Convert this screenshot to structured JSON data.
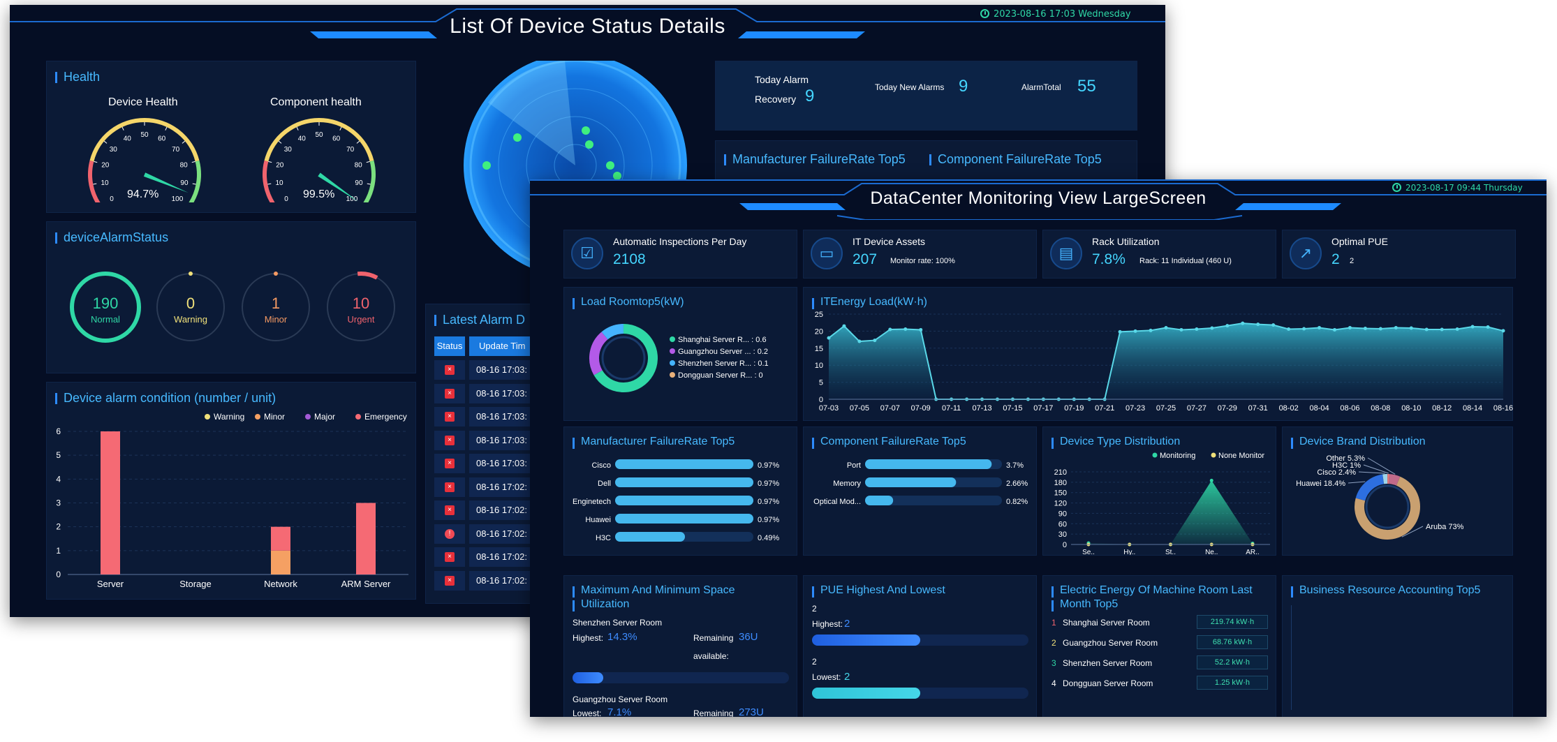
{
  "screen1": {
    "title": "List Of Device Status Details",
    "time": "2023-08-16 17:03 Wednesday",
    "health": {
      "title": "Health",
      "gauges": [
        {
          "label": "Device Health",
          "value": 94.7,
          "value_text": "94.7%",
          "ticks": [
            "0",
            "10",
            "20",
            "30",
            "40",
            "50",
            "60",
            "70",
            "80",
            "90",
            "100"
          ]
        },
        {
          "label": "Component health",
          "value": 99.5,
          "value_text": "99.5%",
          "ticks": [
            "0",
            "10",
            "20",
            "30",
            "40",
            "50",
            "60",
            "70",
            "80",
            "90",
            "100"
          ]
        }
      ]
    },
    "alarm_status": {
      "title": "deviceAlarmStatus",
      "items": [
        {
          "value": "190",
          "label": "Normal",
          "color": "#2fd8a6"
        },
        {
          "value": "0",
          "label": "Warning",
          "color": "#f0e07a"
        },
        {
          "value": "1",
          "label": "Minor",
          "color": "#f59a63"
        },
        {
          "value": "10",
          "label": "Urgent",
          "color": "#f0636d"
        }
      ]
    },
    "alarm_condition": {
      "title": "Device alarm condition (number / unit)",
      "chart_data": {
        "type": "bar",
        "categories": [
          "Server",
          "Storage",
          "Network",
          "ARM Server"
        ],
        "series": [
          {
            "name": "Warning",
            "color": "#f0e07a",
            "values": [
              0,
              0,
              0,
              0
            ]
          },
          {
            "name": "Minor",
            "color": "#f5a063",
            "values": [
              0,
              0,
              1,
              0
            ]
          },
          {
            "name": "Major",
            "color": "#a35ad6",
            "values": [
              0,
              0,
              0,
              0
            ]
          },
          {
            "name": "Emergency",
            "color": "#f56a74",
            "values": [
              6,
              0,
              1,
              3
            ]
          }
        ],
        "y_ticks": [
          "0",
          "1",
          "2",
          "3",
          "4",
          "5",
          "6"
        ],
        "ylim": [
          0,
          6
        ],
        "legend": "top-right"
      }
    },
    "summary": {
      "recovery_label_1": "Today Alarm",
      "recovery_label_2": "Recovery",
      "recovery_value": "9",
      "new_label": "Today New Alarms",
      "new_value": "9",
      "total_label": "AlarmTotal",
      "total_value": "55"
    },
    "manufacturer_title": "Manufacturer FailureRate Top5",
    "component_title": "Component FailureRate Top5",
    "latest_alarm": {
      "title": "Latest Alarm D",
      "col_status": "Status",
      "col_time": "Update Tim",
      "rows": [
        {
          "time": "08-16 17:03:",
          "kind": "x"
        },
        {
          "time": "08-16 17:03:",
          "kind": "x"
        },
        {
          "time": "08-16 17:03:",
          "kind": "x"
        },
        {
          "time": "08-16 17:03:",
          "kind": "x"
        },
        {
          "time": "08-16 17:03:",
          "kind": "x"
        },
        {
          "time": "08-16 17:02:",
          "kind": "x"
        },
        {
          "time": "08-16 17:02:",
          "kind": "x"
        },
        {
          "time": "08-16 17:02:",
          "kind": "!"
        },
        {
          "time": "08-16 17:02:",
          "kind": "x"
        },
        {
          "time": "08-16 17:02:",
          "kind": "x"
        }
      ]
    }
  },
  "screen2": {
    "title": "DataCenter Monitoring View LargeScreen",
    "time": "2023-08-17 09:44 Thursday",
    "kpis": [
      {
        "label": "Automatic Inspections Per Day",
        "value": "2108",
        "sub": "",
        "icon": "calendar-check-icon"
      },
      {
        "label": "IT Device Assets",
        "value": "207",
        "sub": "Monitor rate:  100%",
        "icon": "laptop-icon"
      },
      {
        "label": "Rack Utilization",
        "value": "7.8%",
        "sub": "Rack:  11 Individual (460 U)",
        "icon": "rack-icon"
      },
      {
        "label": "Optimal PUE",
        "value": "2",
        "sub": "2",
        "icon": "trend-chart-icon"
      }
    ],
    "load_room": {
      "title": "Load Roomtop5(kW)",
      "chart_data": {
        "type": "pie",
        "labels": [
          "Shanghai Server R... : 0.6",
          "Guangzhou Server ... : 0.2",
          "Shenzhen Server R... : 0.1",
          "Dongguan Server R... : 0"
        ],
        "values": [
          0.6,
          0.2,
          0.1,
          0
        ],
        "colors": [
          "#2fd8a6",
          "#b35ae8",
          "#45b4ff",
          "#e8b07a"
        ]
      }
    },
    "energy_load": {
      "title": "ITEnergy Load(kW·h)",
      "chart_data": {
        "type": "area",
        "x": [
          "07-03",
          "07-04",
          "07-05",
          "07-06",
          "07-07",
          "07-08",
          "07-09",
          "07-10",
          "07-11",
          "07-12",
          "07-13",
          "07-14",
          "07-15",
          "07-16",
          "07-17",
          "07-18",
          "07-19",
          "07-20",
          "07-21",
          "07-22",
          "07-23",
          "07-24",
          "07-25",
          "07-26",
          "07-27",
          "07-28",
          "07-29",
          "07-30",
          "07-31",
          "08-01",
          "08-02",
          "08-03",
          "08-04",
          "08-05",
          "08-06",
          "08-07",
          "08-08",
          "08-09",
          "08-10",
          "08-11",
          "08-12",
          "08-13",
          "08-14",
          "08-15",
          "08-16"
        ],
        "x_labels": [
          "07-03",
          "07-05",
          "07-07",
          "07-09",
          "07-11",
          "07-13",
          "07-15",
          "07-17",
          "07-19",
          "07-21",
          "07-23",
          "07-25",
          "07-27",
          "07-29",
          "07-31",
          "08-02",
          "08-04",
          "08-06",
          "08-08",
          "08-10",
          "08-12",
          "08-14",
          "08-16"
        ],
        "values": [
          18,
          21.5,
          17,
          17.3,
          20.5,
          20.6,
          20.4,
          0,
          0,
          0,
          0,
          0,
          0,
          0,
          0,
          0,
          0,
          0,
          0,
          19.8,
          20,
          20.2,
          21,
          20.4,
          20.6,
          20.9,
          21.6,
          22.3,
          22,
          21.8,
          20.6,
          20.7,
          21,
          20.4,
          21,
          20.8,
          20.7,
          21,
          20.9,
          20.5,
          20.5,
          20.6,
          21.3,
          21.2,
          20.1
        ],
        "y_ticks": [
          "0",
          "5",
          "10",
          "15",
          "20",
          "25"
        ],
        "ylim": [
          0,
          25
        ]
      }
    },
    "manufacturer": {
      "title": "Manufacturer FailureRate Top5",
      "chart_data": {
        "type": "bar",
        "categories": [
          "Cisco",
          "Dell",
          "Enginetech",
          "Huawei",
          "H3C"
        ],
        "values": [
          0.97,
          0.97,
          0.97,
          0.97,
          0.49
        ],
        "value_labels": [
          "0.97%",
          "0.97%",
          "0.97%",
          "0.97%",
          "0.49%"
        ]
      }
    },
    "component": {
      "title": "Component FailureRate Top5",
      "chart_data": {
        "type": "bar",
        "categories": [
          "Port",
          "Memory",
          "Optical Mod..."
        ],
        "values": [
          3.7,
          2.66,
          0.82
        ],
        "value_labels": [
          "3.7%",
          "2.66%",
          "0.82%"
        ]
      }
    },
    "device_type": {
      "title": "Device Type Distribution",
      "chart_data": {
        "type": "area",
        "categories": [
          "Se..",
          "Hy..",
          "St..",
          "Ne..",
          "AR.."
        ],
        "series": [
          {
            "name": "Monitoring",
            "color": "#2fd8a6",
            "values": [
              4,
              0,
              0,
              185,
              3
            ]
          },
          {
            "name": "None Monitor",
            "color": "#f0e07a",
            "values": [
              0,
              0,
              0,
              0,
              0
            ]
          }
        ],
        "y_ticks": [
          "0",
          "30",
          "60",
          "90",
          "120",
          "150",
          "180",
          "210"
        ],
        "ylim": [
          0,
          210
        ]
      }
    },
    "brand": {
      "title": "Device Brand Distribution",
      "chart_data": {
        "type": "pie",
        "labels": [
          "Aruba 73%",
          "Huawei 18.4%",
          "Cisco 2.4%",
          "H3C 1%",
          "Other 5.3%"
        ],
        "values": [
          73,
          18.4,
          2.4,
          1,
          5.3
        ],
        "colors": [
          "#c9a070",
          "#2d6fe0",
          "#9fd4e8",
          "#e87a7a",
          "#c06a8a"
        ]
      }
    },
    "space": {
      "title_1": "Maximum And Minimum Space",
      "title_2": "Utilization",
      "room_hi": "Shenzhen Server Room",
      "hi_label": "Highest:",
      "hi_value": "14.3%",
      "hi_fraction": 0.143,
      "remain_label_1": "Remaining",
      "remain_label_2": "available:",
      "hi_remain": "36U",
      "room_lo": "Guangzhou Server Room",
      "lo_label": "Lowest:",
      "lo_value": "7.1%",
      "lo_remain": "273U"
    },
    "pue": {
      "title": "PUE Highest And Lowest",
      "hi_top": "2",
      "hi_label": "Highest:",
      "hi_value": "2",
      "lo_top": "2",
      "lo_label": "Lowest:",
      "lo_value": "2",
      "hi_fraction": 0.5,
      "lo_fraction": 0.5
    },
    "electric": {
      "title_1": "Electric Energy Of Machine Room Last",
      "title_2": "Month Top5",
      "rows": [
        {
          "rank": "1",
          "name": "Shanghai Server Room",
          "value": "219.74 kW·h",
          "color": "#f0636d"
        },
        {
          "rank": "2",
          "name": "Guangzhou Server Room",
          "value": "68.76 kW·h",
          "color": "#f0e07a"
        },
        {
          "rank": "3",
          "name": "Shenzhen Server Room",
          "value": "52.2 kW·h",
          "color": "#2fd8a6"
        },
        {
          "rank": "4",
          "name": "Dongguan Server Room",
          "value": "1.25 kW·h",
          "color": "#ffffff"
        }
      ]
    },
    "business": {
      "title": "Business Resource Accounting Top5"
    }
  }
}
